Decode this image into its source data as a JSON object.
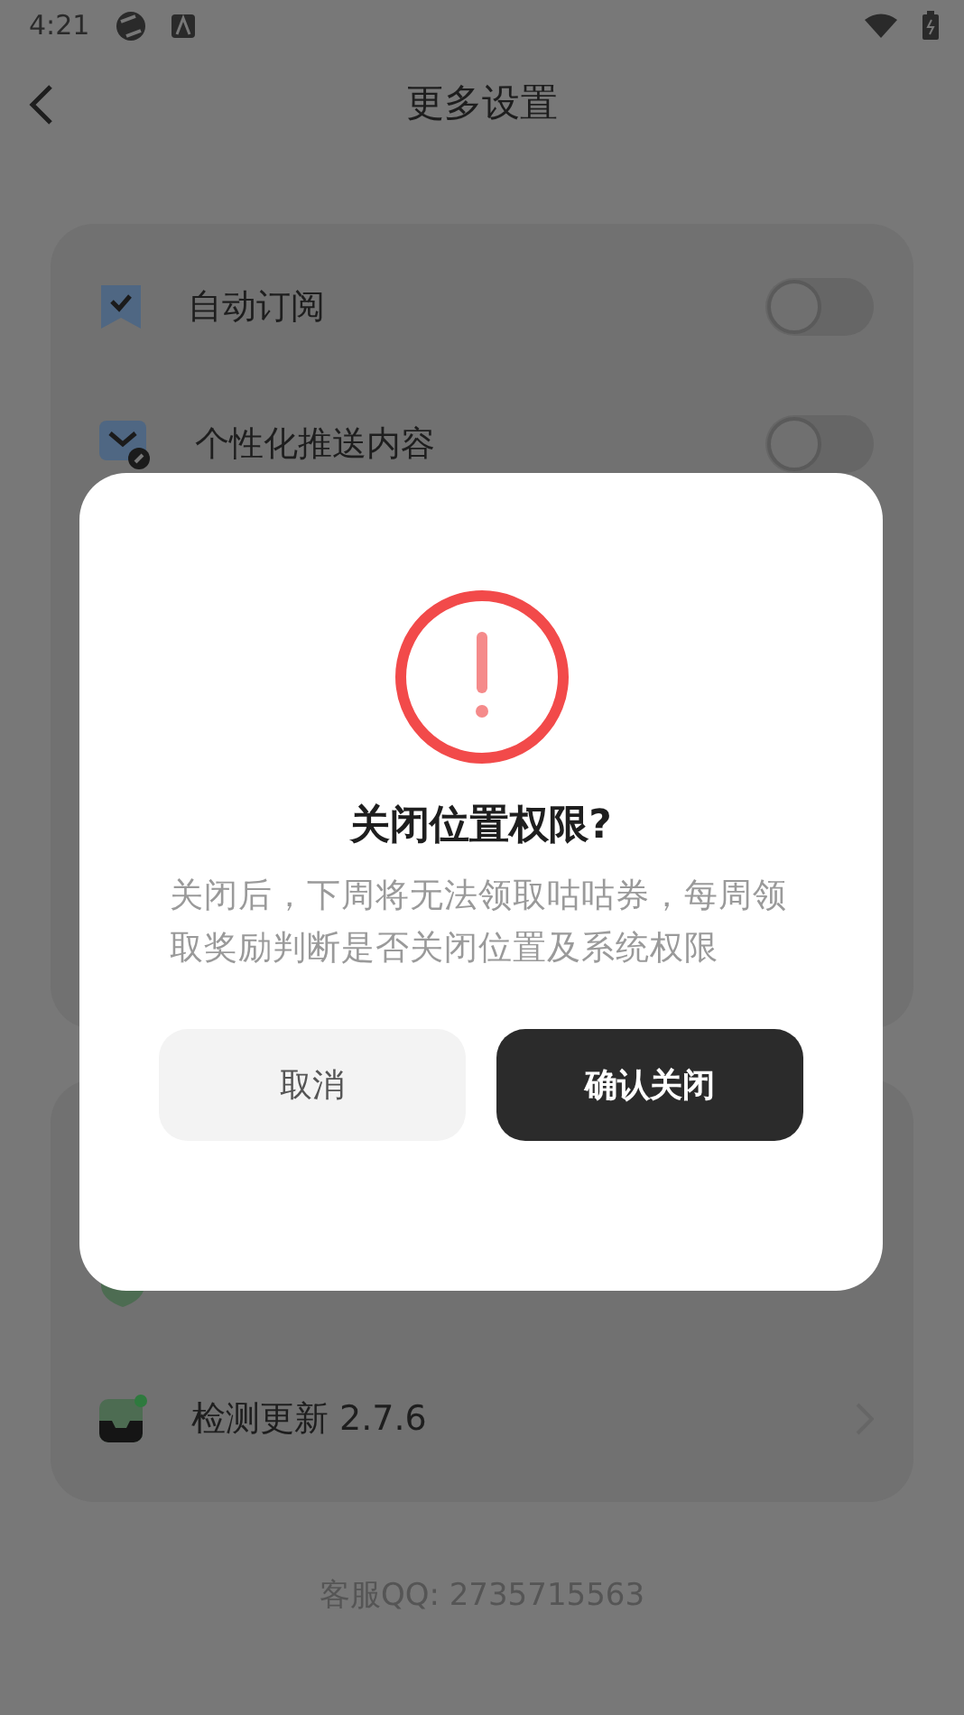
{
  "status_bar": {
    "time": "4:21"
  },
  "header": {
    "title": "更多设置"
  },
  "settings": [
    {
      "label": "自动订阅",
      "kind": "toggle",
      "on": false
    },
    {
      "label": "个性化推送内容",
      "kind": "toggle",
      "on": false
    }
  ],
  "about": [
    {
      "kind": "link"
    },
    {
      "label": "检测更新 2.7.6",
      "kind": "link"
    }
  ],
  "footer": "客服QQ: 2735715563",
  "dialog": {
    "title": "关闭位置权限?",
    "message": "关闭后，下周将无法领取咕咕券，每周领取奖励判断是否关闭位置及系统权限",
    "buttons": [
      {
        "label": "取消",
        "kind": "secondary"
      },
      {
        "label": "确认关闭",
        "kind": "primary"
      }
    ]
  }
}
